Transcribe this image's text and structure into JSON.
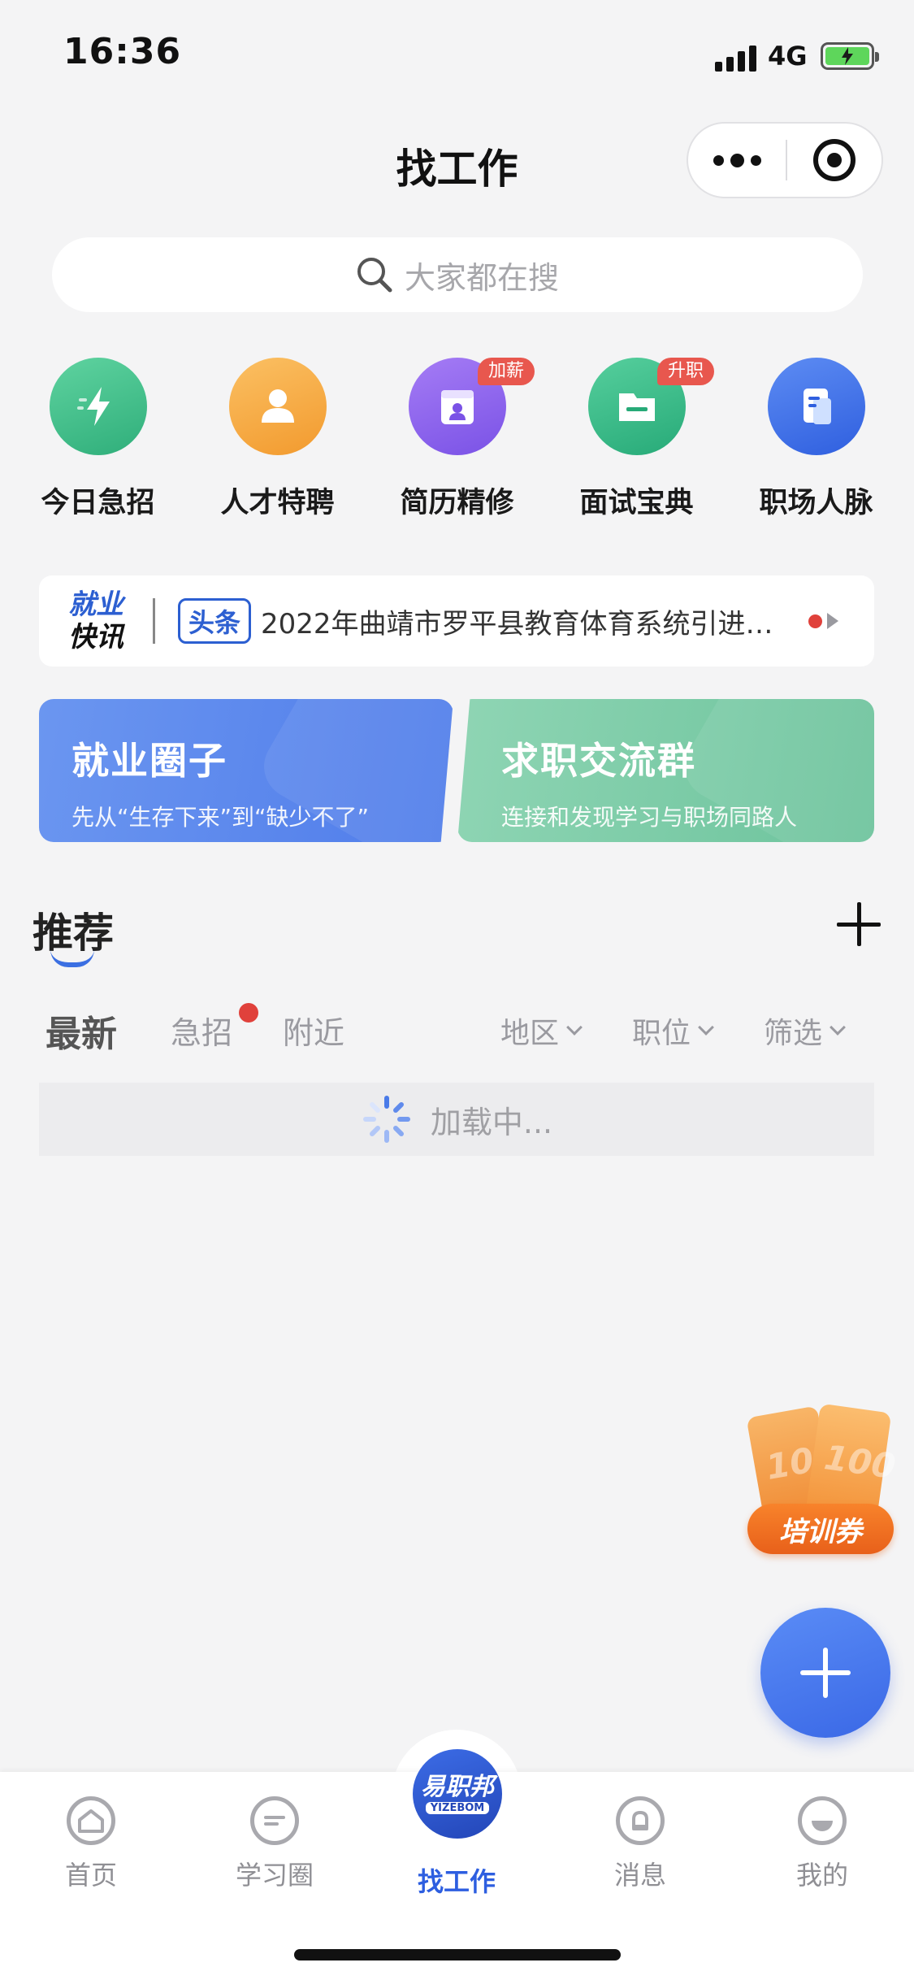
{
  "status_bar": {
    "time": "16:36",
    "network": "4G"
  },
  "header": {
    "title": "找工作"
  },
  "search": {
    "placeholder": "大家都在搜"
  },
  "quick_entries": [
    {
      "label": "今日急招",
      "icon": "lightning-icon",
      "badge": "",
      "color": "#3fbf8a"
    },
    {
      "label": "人才特聘",
      "icon": "person-icon",
      "badge": "",
      "color": "#f6a93e"
    },
    {
      "label": "简历精修",
      "icon": "resume-icon",
      "badge": "加薪",
      "color": "#8a62ee"
    },
    {
      "label": "面试宝典",
      "icon": "folder-icon",
      "badge": "升职",
      "color": "#33b98a"
    },
    {
      "label": "职场人脉",
      "icon": "document-icon",
      "badge": "",
      "color": "#3d6fe8"
    }
  ],
  "news": {
    "logo_line1": "就业",
    "logo_line2": "快讯",
    "tag": "头条",
    "text": "2022年曲靖市罗平县教育体育系统引进…"
  },
  "cards": [
    {
      "title": "就业圈子",
      "subtitle": "先从“生存下来”到“缺少不了”"
    },
    {
      "title": "求职交流群",
      "subtitle": "连接和发现学习与职场同路人"
    }
  ],
  "recommend": {
    "title": "推荐",
    "tabs": [
      "最新",
      "急招",
      "附近"
    ],
    "dropdowns": [
      "地区",
      "职位",
      "筛选"
    ],
    "loading_text": "加载中..."
  },
  "floating": {
    "coupon_label": "培训券",
    "coupon_digits": "100"
  },
  "tabbar": {
    "items": [
      {
        "label": "首页",
        "icon": "home-icon"
      },
      {
        "label": "学习圈",
        "icon": "chat-icon"
      },
      {
        "label": "找工作",
        "icon": "brand-logo"
      },
      {
        "label": "消息",
        "icon": "bell-icon"
      },
      {
        "label": "我的",
        "icon": "profile-icon"
      }
    ],
    "logo_cn": "易职邦",
    "logo_en": "YIZEBOM"
  },
  "colors": {
    "accent": "#2d5ee0",
    "badge_red": "#e8574e",
    "card_blue": "#5b86ec",
    "card_green": "#7ccba7"
  }
}
